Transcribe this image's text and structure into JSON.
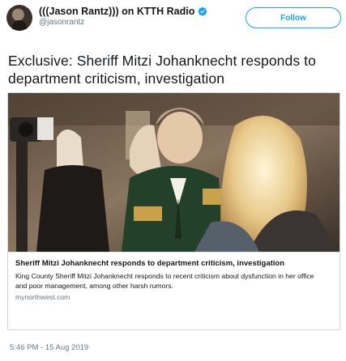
{
  "author": {
    "display_name": "(((Jason Rantz))) on KTTH Radio",
    "handle": "@jasonrantz",
    "verified": true,
    "avatar_icon": "user-avatar-icon"
  },
  "follow_label": "Follow",
  "tweet": {
    "text": "Exclusive: Sheriff Mitzi Johanknecht responds to department criticism, investigation"
  },
  "card": {
    "title": "Sheriff Mitzi Johanknecht responds to department criticism, investigation",
    "description": "King County Sheriff Mitzi Johanknecht responds to recent criticism about dysfunction in her office and poor management, among other harsh rumors.",
    "domain": "mynorthwest.com"
  },
  "timestamp": "5:46 PM - 15 Aug 2019",
  "colors": {
    "accent": "#1da1f2",
    "secondary_text": "#657786",
    "border": "#ccd6dd"
  }
}
